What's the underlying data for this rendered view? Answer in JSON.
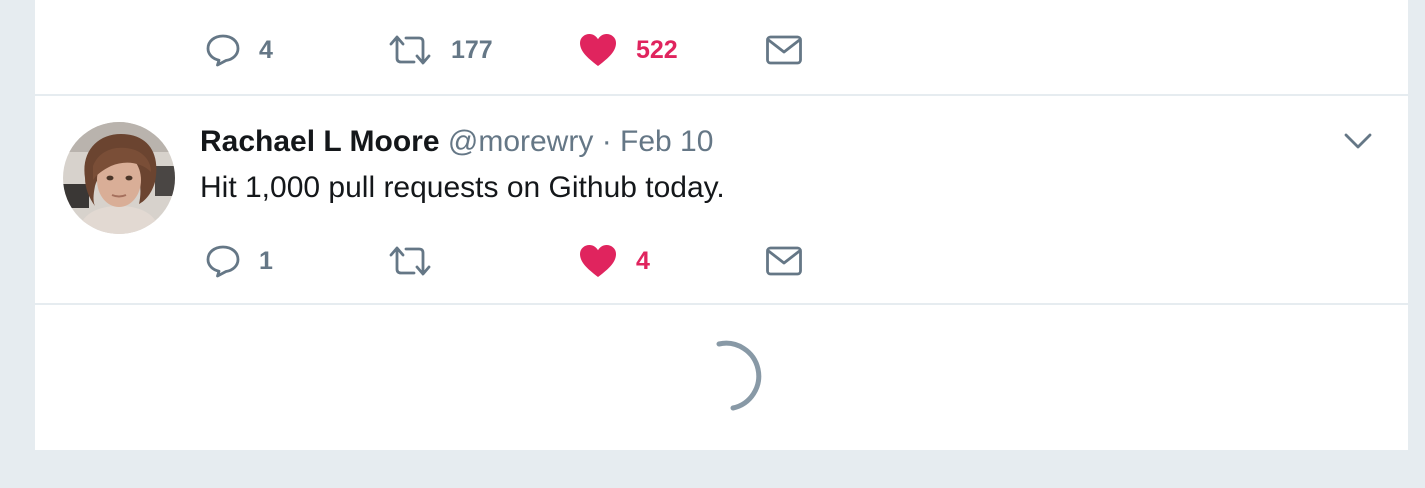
{
  "top_tweet": {
    "replies": "4",
    "retweets": "177",
    "likes": "522",
    "liked": true
  },
  "tweet": {
    "fullname": "Rachael L Moore",
    "username": "@morewry",
    "separator": "·",
    "time": "Feb 10",
    "text": "Hit 1,000 pull requests on Github today.",
    "replies": "1",
    "retweets": "",
    "likes": "4",
    "liked": true
  },
  "icons": {
    "reply": "reply-icon",
    "retweet": "retweet-icon",
    "like": "heart-icon",
    "dm": "envelope-icon",
    "caret": "chevron-down-icon",
    "loading": "loading-spinner"
  },
  "colors": {
    "like": "#e0245e",
    "icon": "#657786",
    "background": "#e6ecf0"
  }
}
